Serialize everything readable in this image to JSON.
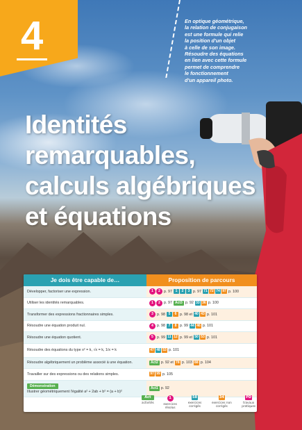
{
  "chapter": {
    "number": "4"
  },
  "intro": [
    "En optique géométrique,",
    "la relation de conjugaison",
    "est une formule qui relie",
    "la position d'un objet",
    "à celle de son image.",
    "Résoudre des équations",
    "en lien avec cette formule",
    "permet de comprendre",
    "le fonctionnement",
    "d'un appareil photo."
  ],
  "title": [
    "Identités",
    "remarquables,",
    "calculs algébriques",
    "et équations"
  ],
  "table": {
    "header_left": "Je dois être capable de…",
    "header_right": "Proposition de parcours",
    "rows": [
      {
        "skill": "Développer, factoriser une expression.",
        "path": {
          "c1": "1",
          "c2": "2",
          "p1": "p. 97",
          "s1": "1",
          "s2": "2",
          "s3": "3",
          "p2": "p. 97",
          "s4": "71",
          "s5": "72",
          "s6": "74",
          "s7": "97",
          "p3": "p. 100"
        }
      },
      {
        "skill": "Utiliser les identités remarquables.",
        "path": {
          "c1": "1",
          "c2": "2",
          "p1": "p. 97",
          "act": "Act3",
          "p2": "p. 92",
          "s1": "33",
          "s2": "36",
          "p3": "p. 100"
        }
      },
      {
        "skill": "Transformer des expressions fractionnaires simples.",
        "path": {
          "c1": "3",
          "p1": "p. 98",
          "s1": "5",
          "s2": "6",
          "p2": "p. 98 et",
          "s3": "40",
          "s4": "43",
          "p3": "p. 101"
        }
      },
      {
        "skill": "Résoudre une équation produit nul.",
        "path": {
          "c1": "4",
          "p1": "p. 98",
          "s1": "7",
          "s2": "8",
          "p2": "p. 99",
          "s3": "44",
          "s4": "46",
          "p3": "p. 101"
        }
      },
      {
        "skill": "Résoudre une équation quotient.",
        "path": {
          "c1": "5",
          "p1": "p. 99",
          "s1": "11",
          "s2": "12",
          "p2": "p. 99 et",
          "s3": "50",
          "s4": "53",
          "p3": "p. 101"
        }
      },
      {
        "skill": "Résoudre des équations du type x² = k, √x = k, 1/x = k",
        "path": {
          "s1": "47",
          "s2": "48",
          "s3": "53",
          "p1": "p. 101"
        }
      },
      {
        "skill": "Résoudre algébriquement un problème associé à une équation.",
        "path": {
          "act": "Act2",
          "p1": "p. 92 et",
          "s1": "78",
          "p2": "p. 103",
          "s2": "88",
          "p3": "p. 104"
        }
      },
      {
        "skill": "Travailler sur des expressions ou des relations simples.",
        "path": {
          "s1": "97",
          "s2": "99",
          "p1": "p. 105"
        }
      },
      {
        "skill_badge": "Démonstration",
        "skill": "Illustrer géométriquement l'égalité a² + 2ab + b² = (a + b)²",
        "path": {
          "act": "Act1",
          "p1": "p. 92"
        }
      }
    ],
    "legend": [
      {
        "tag": "Act 1",
        "label": "activités"
      },
      {
        "tag": "1",
        "label": "exercices résolus"
      },
      {
        "tag": "58",
        "label": "exercices corrigés"
      },
      {
        "tag": "34",
        "label": "exercices non corrigés"
      },
      {
        "tag": "PD",
        "label": "travaux pratiques"
      }
    ]
  },
  "colors": {
    "orange": "#f18f1e",
    "teal": "#2aa1b1",
    "magenta": "#e3137e",
    "green": "#56b04f",
    "tab": "#f7a81b"
  }
}
